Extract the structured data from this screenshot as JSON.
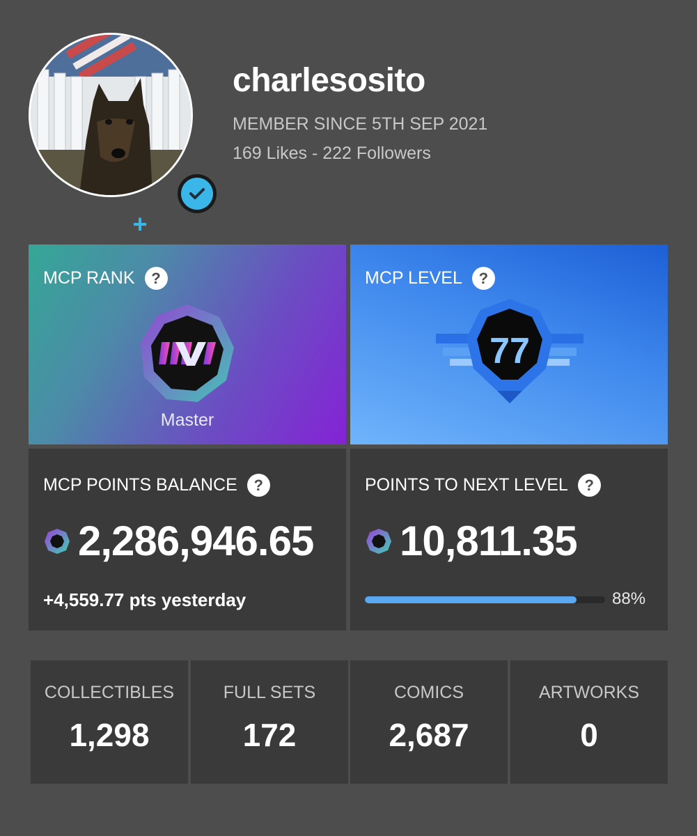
{
  "profile": {
    "username": "charlesosito",
    "member_since": "MEMBER SINCE 5TH SEP 2021",
    "social": "169 Likes - 222 Followers",
    "add_symbol": "+"
  },
  "rank": {
    "title": "MCP RANK",
    "help": "?",
    "name": "Master"
  },
  "level": {
    "title": "MCP LEVEL",
    "help": "?",
    "value": "77"
  },
  "balance": {
    "title": "MCP POINTS BALANCE",
    "help": "?",
    "value": "2,286,946.65",
    "yesterday": "+4,559.77 pts yesterday"
  },
  "next_level": {
    "title": "POINTS TO NEXT LEVEL",
    "help": "?",
    "value": "10,811.35",
    "progress_fraction": 0.88,
    "progress_label": "88%"
  },
  "stats": [
    {
      "label": "COLLECTIBLES",
      "value": "1,298"
    },
    {
      "label": "FULL SETS",
      "value": "172"
    },
    {
      "label": "COMICS",
      "value": "2,687"
    },
    {
      "label": "ARTWORKS",
      "value": "0"
    }
  ],
  "colors": {
    "background": "#4d4d4d",
    "card": "#3a3a3a",
    "accent": "#3bb6e8",
    "progress": "#5aa8f2"
  },
  "icons": {
    "verified": "verified-check-icon",
    "add": "plus-icon",
    "help": "question-icon",
    "points": "points-coin-icon",
    "rank": "master-rank-badge-icon",
    "level": "level-badge-icon"
  }
}
